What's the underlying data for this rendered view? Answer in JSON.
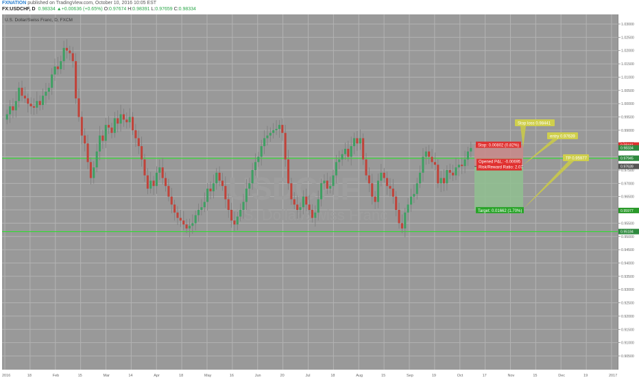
{
  "header": {
    "publisher": "FXNATION",
    "published_text": " published on TradingView.com, October 10, 2016 10:05 EST",
    "symbol": "FX:USDCHF, D",
    "price": "0.98334",
    "change": "+0.00636 (+0.65%)",
    "o_label": "O:",
    "o_value": "0.97674",
    "h_label": "H:",
    "h_value": "0.98391",
    "l_label": "L:",
    "l_value": "0.97659",
    "c_label": "C:",
    "c_value": "0.98334"
  },
  "chart": {
    "legend": "U.S. Dollar/Swiss Franc, D, FXCM",
    "watermark_symbol": "USDCHF",
    "watermark_name": "U.S. Dollar/Swiss Franc",
    "colors": {
      "background": "#999999",
      "grid": "#b3b3b3",
      "up": "#3f9f63",
      "down": "#c0433a",
      "hline": "#37d837"
    },
    "y_axis": {
      "min": 0.9,
      "max": 1.03,
      "ticks": [
        "1.03000",
        "1.02500",
        "1.02000",
        "1.01500",
        "1.01000",
        "1.00500",
        "1.00000",
        "0.99500",
        "0.99000",
        "0.98500",
        "0.98000",
        "0.97500",
        "0.97000",
        "0.96500",
        "0.96000",
        "0.95500",
        "0.95000",
        "0.94500",
        "0.94000",
        "0.93500",
        "0.93000",
        "0.92500",
        "0.92000",
        "0.91500",
        "0.91000",
        "0.90500"
      ],
      "badges": [
        {
          "value": 0.98441,
          "label": "0.98441",
          "color": "#e03030"
        },
        {
          "value": 0.98334,
          "label": "0.98334",
          "color": "#2f8a3f"
        },
        {
          "value": 0.97945,
          "label": "0.97945",
          "color": "#2f8a3f"
        },
        {
          "value": 0.97639,
          "label": "0.97639",
          "color": "#555555"
        },
        {
          "value": 0.95977,
          "label": "0.95977",
          "color": "#2a9a2a"
        },
        {
          "value": 0.95184,
          "label": "0.95184",
          "color": "#2f8a3f"
        }
      ]
    },
    "x_axis": {
      "labels": [
        "2016",
        "18",
        "Feb",
        "15",
        "Mar",
        "14",
        "Apr",
        "18",
        "May",
        "16",
        "Jun",
        "20",
        "Jul",
        "18",
        "Aug",
        "15",
        "Sep",
        "19",
        "Oct",
        "17",
        "Nov",
        "15",
        "Dec",
        "19",
        "2017"
      ]
    },
    "hlines": [
      0.97945,
      0.95184
    ],
    "position": {
      "stop_label": "Stop: 0.00802 (0.82%)",
      "target_label": "Target: 0.01662 (1.70%)",
      "pnl_label": "Opened P&L: -0.00695",
      "rr_label": "Risk/Reward Ratio: 2.07",
      "entry": 0.97639,
      "stop": 0.98441,
      "target": 0.95977
    },
    "callouts": [
      {
        "text": "Stop loss 0.98441"
      },
      {
        "text": "entry 0.97639"
      },
      {
        "text": "TP 0.95977"
      }
    ]
  },
  "chart_data": {
    "type": "candlestick",
    "symbol": "FX:USDCHF",
    "timeframe": "D",
    "ylim": [
      0.9,
      1.03
    ],
    "series": [
      {
        "name": "U.S. Dollar/Swiss Franc",
        "closes": [
          0.996,
          0.999,
          0.9975,
          1.001,
          1.006,
          1.003,
          1.002,
          1.0,
          0.999,
          0.9985,
          1.001,
          0.9995,
          1.003,
          1.0045,
          1.006,
          1.011,
          1.014,
          1.013,
          1.016,
          1.021,
          1.02,
          1.019,
          1.016,
          1.002,
          0.995,
          0.988,
          0.985,
          0.978,
          0.972,
          0.976,
          0.982,
          0.988,
          0.986,
          0.992,
          0.991,
          0.989,
          0.9945,
          0.9925,
          0.996,
          0.994,
          0.993,
          0.995,
          0.99,
          0.987,
          0.984,
          0.979,
          0.973,
          0.968,
          0.971,
          0.969,
          0.974,
          0.976,
          0.972,
          0.969,
          0.965,
          0.962,
          0.959,
          0.957,
          0.956,
          0.9545,
          0.953,
          0.954,
          0.955,
          0.958,
          0.96,
          0.961,
          0.963,
          0.968,
          0.967,
          0.97,
          0.974,
          0.971,
          0.969,
          0.964,
          0.96,
          0.956,
          0.9545,
          0.9575,
          0.96,
          0.963,
          0.968,
          0.97,
          0.975,
          0.978,
          0.98,
          0.984,
          0.987,
          0.988,
          0.989,
          0.99,
          0.9905,
          0.992,
          0.989,
          0.979,
          0.97,
          0.964,
          0.962,
          0.96,
          0.961,
          0.965,
          0.962,
          0.96,
          0.957,
          0.959,
          0.964,
          0.97,
          0.971,
          0.968,
          0.969,
          0.973,
          0.978,
          0.979,
          0.981,
          0.983,
          0.98,
          0.984,
          0.987,
          0.985,
          0.987,
          0.979,
          0.973,
          0.97,
          0.965,
          0.963,
          0.971,
          0.974,
          0.972,
          0.969,
          0.968,
          0.965,
          0.96,
          0.955,
          0.953,
          0.959,
          0.962,
          0.965,
          0.966,
          0.97,
          0.974,
          0.98,
          0.982,
          0.98,
          0.978,
          0.977,
          0.97,
          0.972,
          0.97,
          0.975,
          0.974,
          0.973,
          0.976,
          0.977,
          0.9765,
          0.979,
          0.982,
          0.9833
        ]
      }
    ]
  }
}
